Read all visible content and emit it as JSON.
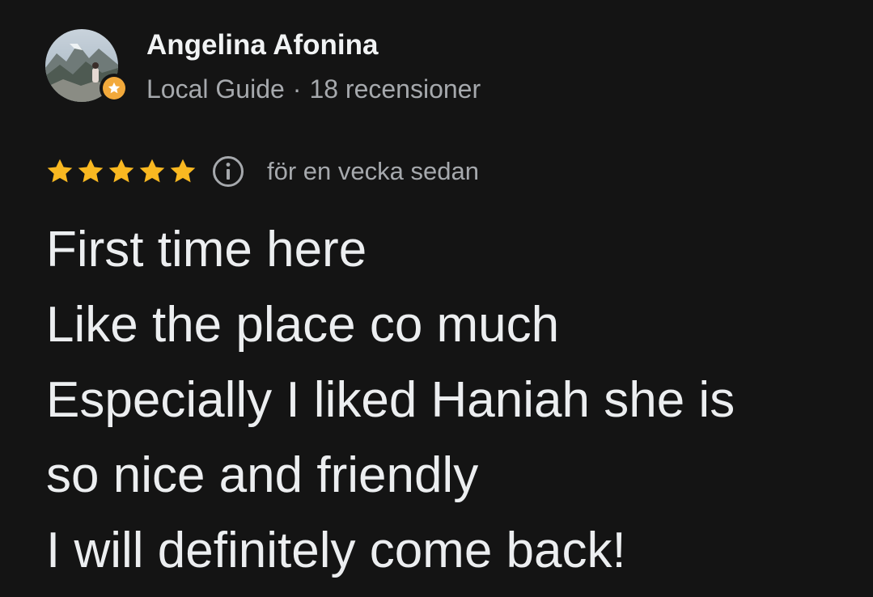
{
  "author": {
    "name": "Angelina Afonina",
    "role": "Local Guide",
    "separator": "·",
    "review_count": "18 recensioner",
    "avatar": "mountain-landscape-photo",
    "badge_icon": "local-guide-star-icon",
    "badge_color": "#f2a93b"
  },
  "rating": {
    "stars": 5,
    "max": 5,
    "star_color": "#f9b821",
    "info_icon": "info-icon",
    "date": "för en vecka sedan"
  },
  "review": {
    "text": "First time here\nLike the place co much\nEspecially I liked Haniah she is\nso nice and friendly\nI will definitely come back!"
  },
  "theme": {
    "background": "#141414",
    "primary_text": "#eceef0",
    "secondary_text": "#a6a9ad"
  }
}
